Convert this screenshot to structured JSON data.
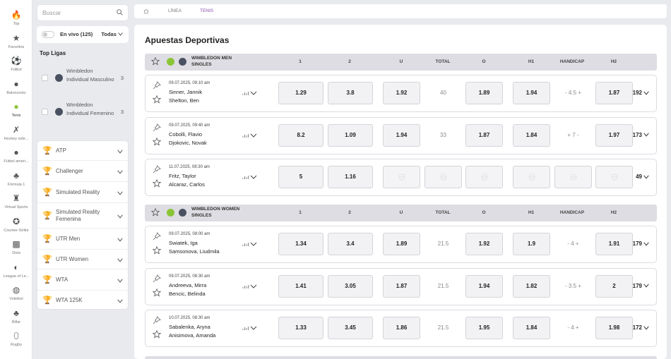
{
  "nav_rail": [
    {
      "label": "Top",
      "icon": "flame-icon",
      "glyph": "🔥"
    },
    {
      "label": "Favoritos",
      "icon": "star-icon",
      "glyph": "★"
    },
    {
      "label": "Fútbol",
      "icon": "soccer-ball-icon",
      "glyph": "⚽"
    },
    {
      "label": "Baloncesto",
      "icon": "basketball-icon",
      "glyph": "●"
    },
    {
      "label": "Tenis",
      "icon": "tennis-ball-icon",
      "glyph": "●",
      "active": true
    },
    {
      "label": "Hockey sobr...",
      "icon": "hockey-icon",
      "glyph": "✗"
    },
    {
      "label": "Fútbol ameri...",
      "icon": "american-football-icon",
      "glyph": "●"
    },
    {
      "label": "Fórmula 1",
      "icon": "formula1-icon",
      "glyph": "♣"
    },
    {
      "label": "Virtual Sports",
      "icon": "virtual-sports-icon",
      "glyph": "♜"
    },
    {
      "label": "Counter-Strike",
      "icon": "counter-strike-icon",
      "glyph": "✪"
    },
    {
      "label": "Dota",
      "icon": "dota-icon",
      "glyph": "▩"
    },
    {
      "label": "League of Le...",
      "icon": "league-of-legends-icon",
      "glyph": "◐"
    },
    {
      "label": "Voleibol",
      "icon": "volleyball-icon",
      "glyph": "◍"
    },
    {
      "label": "Billar",
      "icon": "billiards-icon",
      "glyph": "♣"
    },
    {
      "label": "Rugby",
      "icon": "rugby-icon",
      "glyph": "⬯"
    }
  ],
  "search": {
    "placeholder": "Buscar"
  },
  "live": {
    "label": "En vivo (125)",
    "filter": "Todas"
  },
  "top_leagues": {
    "title": "Top Ligas",
    "items": [
      {
        "name": "Wimbledon Individual Masculino",
        "count": "3"
      },
      {
        "name": "Wimbledon Individual Femenino",
        "count": "3"
      }
    ]
  },
  "categories": [
    {
      "name": "ATP"
    },
    {
      "name": "Challenger"
    },
    {
      "name": "Simulated Reality"
    },
    {
      "name": "Simulated Reality Femenina"
    },
    {
      "name": "UTR Men"
    },
    {
      "name": "UTR Women"
    },
    {
      "name": "WTA"
    },
    {
      "name": "WTA 125K"
    }
  ],
  "breadcrumb": {
    "c1": "LÍNEA",
    "c2": "TENIS"
  },
  "page_title": "Apuestas Deportivas",
  "columns": [
    "1",
    "2",
    "U",
    "TOTAL",
    "O",
    "H1",
    "HANDICAP",
    "H2"
  ],
  "groups": [
    {
      "title_l1": "WIMBLEDON MEN",
      "title_l2": "SINGLES",
      "matches": [
        {
          "time": "09.07.2025, 09:10 am",
          "home": "Sinner, Jannik",
          "away": "Shelton, Ben",
          "o1": "1.29",
          "o2": "3.8",
          "u": "1.92",
          "total": "40",
          "o": "1.89",
          "h1": "1.94",
          "handicap": "- 4.5 +",
          "h2": "1.87",
          "more": "192"
        },
        {
          "time": "09.07.2025, 09:40 am",
          "home": "Cobolli, Flavio",
          "away": "Djokovic, Novak",
          "o1": "8.2",
          "o2": "1.09",
          "u": "1.94",
          "total": "33",
          "o": "1.87",
          "h1": "1.84",
          "handicap": "+ 7 -",
          "h2": "1.97",
          "more": "173"
        },
        {
          "time": "11.07.2025, 08:30 am",
          "home": "Fritz, Taylor",
          "away": "Alcaraz, Carlos",
          "o1": "5",
          "o2": "1.16",
          "u": "",
          "total": "",
          "o": "",
          "h1": "",
          "handicap": "",
          "h2": "",
          "more": "49",
          "locked": true
        }
      ]
    },
    {
      "title_l1": "WIMBLEDON WOMEN",
      "title_l2": "SINGLES",
      "matches": [
        {
          "time": "09.07.2025, 08:00 am",
          "home": "Swiatek, Iga",
          "away": "Samsonova, Liudmila",
          "o1": "1.34",
          "o2": "3.4",
          "u": "1.89",
          "total": "21.5",
          "o": "1.92",
          "h1": "1.9",
          "handicap": "- 4 +",
          "h2": "1.91",
          "more": "179"
        },
        {
          "time": "09.07.2025, 08:30 am",
          "home": "Andreeva, Mirra",
          "away": "Bencic, Belinda",
          "o1": "1.41",
          "o2": "3.05",
          "u": "1.87",
          "total": "21.5",
          "o": "1.94",
          "h1": "1.82",
          "handicap": "- 3.5 +",
          "h2": "2",
          "more": "179"
        },
        {
          "time": "10.07.2025, 08:30 am",
          "home": "Sabalenka, Aryna",
          "away": "Anisimova, Amanda",
          "o1": "1.33",
          "o2": "3.45",
          "u": "1.86",
          "total": "21.5",
          "o": "1.95",
          "h1": "1.84",
          "handicap": "- 4 +",
          "h2": "1.98",
          "more": "172"
        }
      ]
    }
  ],
  "colors": {
    "accent": "#8a4dab",
    "tennis": "#8ac537",
    "trophy": "#e7a82b"
  }
}
